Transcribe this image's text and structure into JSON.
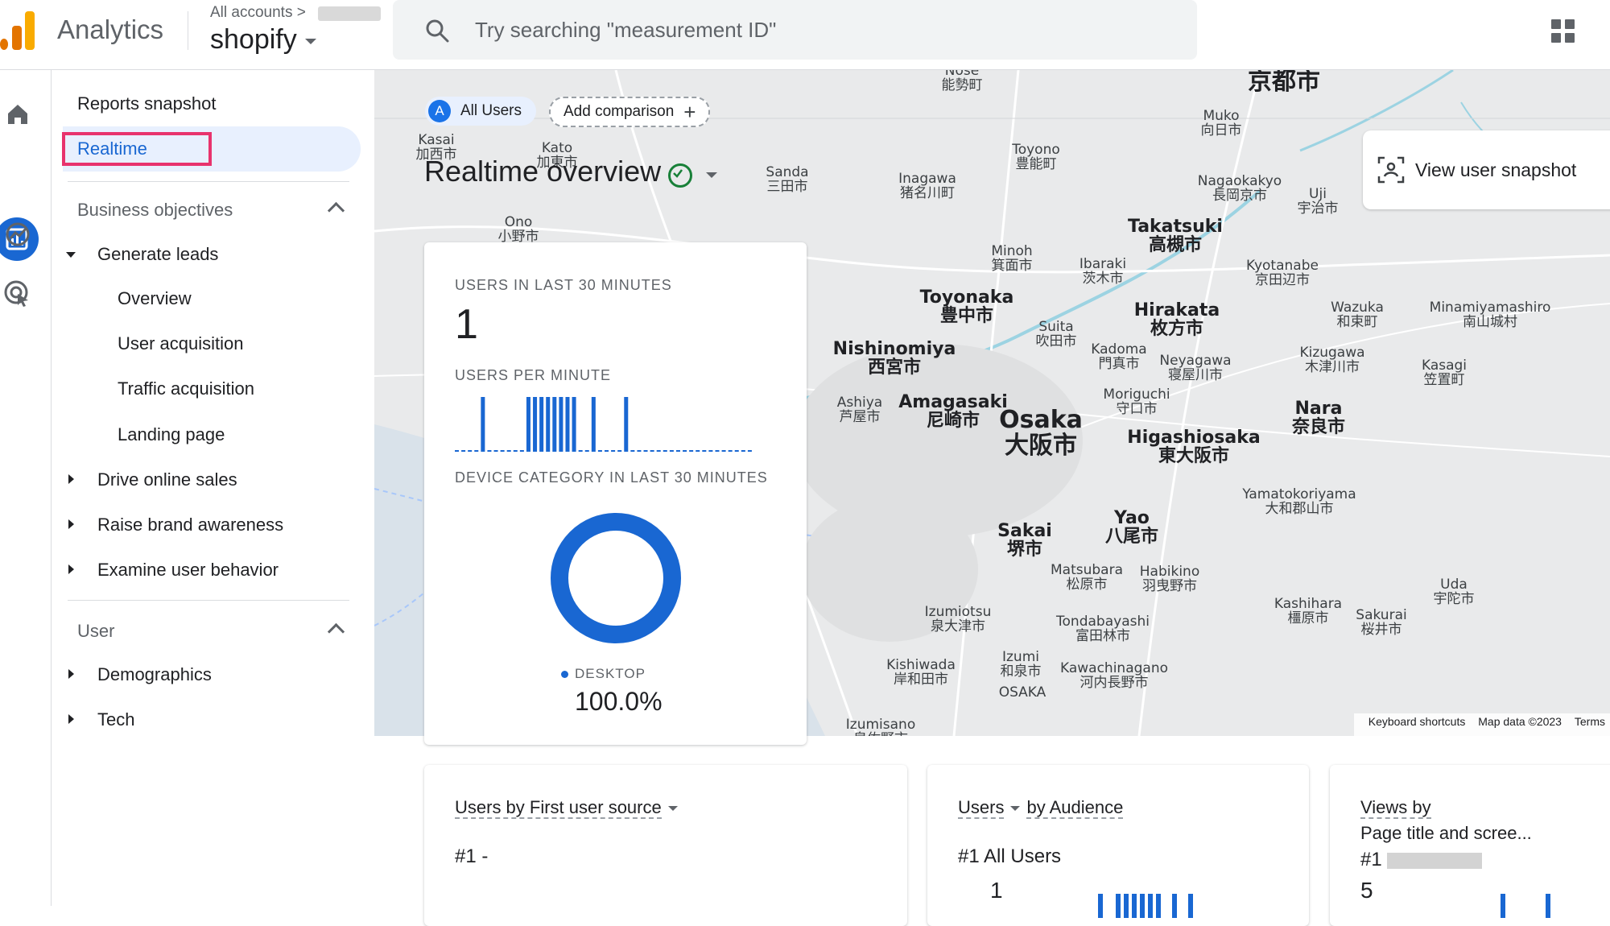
{
  "header": {
    "app_name": "Analytics",
    "breadcrumb": "All accounts",
    "breadcrumb_sep": ">",
    "property": "shopify",
    "search_placeholder": "Try searching \"measurement ID\""
  },
  "nav": {
    "reports_snapshot": "Reports snapshot",
    "realtime": "Realtime",
    "business_objectives": "Business objectives",
    "generate_leads": "Generate leads",
    "overview": "Overview",
    "user_acquisition": "User acquisition",
    "traffic_acquisition": "Traffic acquisition",
    "landing_page": "Landing page",
    "drive_online_sales": "Drive online sales",
    "raise_brand_awareness": "Raise brand awareness",
    "examine_user_behavior": "Examine user behavior",
    "user": "User",
    "demographics": "Demographics",
    "tech": "Tech"
  },
  "realtime": {
    "chip_all_letter": "A",
    "chip_all": "All Users",
    "chip_add": "Add comparison",
    "title": "Realtime overview",
    "view_snapshot": "View user snapshot"
  },
  "users_card": {
    "users_last30_caption": "USERS IN LAST 30 MINUTES",
    "users_last30": "1",
    "per_minute_caption": "USERS PER MINUTE",
    "per_minute_values": [
      0,
      0,
      0,
      0,
      1,
      0,
      0,
      0,
      0,
      0,
      0,
      1,
      1,
      1,
      1,
      1,
      1,
      1,
      1,
      0,
      0,
      1,
      0,
      0,
      0,
      0,
      1,
      0,
      0,
      0,
      0,
      0,
      0,
      0,
      0,
      0,
      0,
      0,
      0,
      0,
      0,
      0,
      0,
      0,
      0,
      0
    ],
    "device_caption": "DEVICE CATEGORY IN LAST 30 MINUTES",
    "device_label": "DESKTOP",
    "device_pct": "100.0%",
    "device_fraction": 1.0
  },
  "bottom_cards": {
    "card1_title": "Users by First user source",
    "card1_rank": "#1",
    "card1_value": "-",
    "card2_metric": "Users",
    "card2_title": "by Audience",
    "card2_rank": "#1",
    "card2_rank_value": "All Users",
    "card2_count": "1",
    "card3_title_line1": "Views by",
    "card3_title_line2": "Page title and scree...",
    "card3_rank": "#1",
    "card3_count": "5"
  },
  "map": {
    "places": [
      {
        "en": "Nose",
        "jp": "能勢町",
        "cls": "small"
      },
      {
        "en": "",
        "jp": "京都市",
        "cls": "big"
      },
      {
        "en": "Muko",
        "jp": "向日市",
        "cls": "small"
      },
      {
        "en": "Kasai",
        "jp": "加西市",
        "cls": "small"
      },
      {
        "en": "Kato",
        "jp": "加東市",
        "cls": "small"
      },
      {
        "en": "Toyono",
        "jp": "豊能町",
        "cls": "small"
      },
      {
        "en": "Sanda",
        "jp": "三田市",
        "cls": "small"
      },
      {
        "en": "Inagawa",
        "jp": "猪名川町",
        "cls": "small"
      },
      {
        "en": "Nagaokakyo",
        "jp": "長岡京市",
        "cls": "small"
      },
      {
        "en": "Uji",
        "jp": "宇治市",
        "cls": "small"
      },
      {
        "en": "Ono",
        "jp": "小野市",
        "cls": "small"
      },
      {
        "en": "Takatsuki",
        "jp": "高槻市",
        "cls": "mid"
      },
      {
        "en": "Minoh",
        "jp": "箕面市",
        "cls": "small"
      },
      {
        "en": "Ibaraki",
        "jp": "茨木市",
        "cls": "small"
      },
      {
        "en": "Kyotanabe",
        "jp": "京田辺市",
        "cls": "small"
      },
      {
        "en": "Toyonaka",
        "jp": "豊中市",
        "cls": "mid"
      },
      {
        "en": "Hirakata",
        "jp": "枚方市",
        "cls": "mid"
      },
      {
        "en": "Wazuka",
        "jp": "和束町",
        "cls": "small"
      },
      {
        "en": "Minamiyamashiro",
        "jp": "南山城村",
        "cls": "small"
      },
      {
        "en": "Suita",
        "jp": "吹田市",
        "cls": "small"
      },
      {
        "en": "Nishinomiya",
        "jp": "西宮市",
        "cls": "mid"
      },
      {
        "en": "Kadoma",
        "jp": "門真市",
        "cls": "small"
      },
      {
        "en": "Neyagawa",
        "jp": "寝屋川市",
        "cls": "small"
      },
      {
        "en": "Kizugawa",
        "jp": "木津川市",
        "cls": "small"
      },
      {
        "en": "Kasagi",
        "jp": "笠置町",
        "cls": "small"
      },
      {
        "en": "Moriguchi",
        "jp": "守口市",
        "cls": "small"
      },
      {
        "en": "Ashiya",
        "jp": "芦屋市",
        "cls": "small"
      },
      {
        "en": "Amagasaki",
        "jp": "尼崎市",
        "cls": "mid"
      },
      {
        "en": "Osaka",
        "jp": "大阪市",
        "cls": "big"
      },
      {
        "en": "Nara",
        "jp": "奈良市",
        "cls": "mid"
      },
      {
        "en": "Higashiosaka",
        "jp": "東大阪市",
        "cls": "mid"
      },
      {
        "en": "Yamatokoriyama",
        "jp": "大和郡山市",
        "cls": "small"
      },
      {
        "en": "Yao",
        "jp": "八尾市",
        "cls": "mid"
      },
      {
        "en": "Sakai",
        "jp": "堺市",
        "cls": "mid"
      },
      {
        "en": "Matsubara",
        "jp": "松原市",
        "cls": "small"
      },
      {
        "en": "Habikino",
        "jp": "羽曳野市",
        "cls": "small"
      },
      {
        "en": "Uda",
        "jp": "宇陀市",
        "cls": "small"
      },
      {
        "en": "Kashihara",
        "jp": "橿原市",
        "cls": "small"
      },
      {
        "en": "Sakurai",
        "jp": "桜井市",
        "cls": "small"
      },
      {
        "en": "Izumiotsu",
        "jp": "泉大津市",
        "cls": "small"
      },
      {
        "en": "Tondabayashi",
        "jp": "富田林市",
        "cls": "small"
      },
      {
        "en": "Kishiwada",
        "jp": "岸和田市",
        "cls": "small"
      },
      {
        "en": "Izumi",
        "jp": "和泉市",
        "cls": "small"
      },
      {
        "en": "Kawachinagano",
        "jp": "河内長野市",
        "cls": "small"
      },
      {
        "en": "OSAKA",
        "jp": "",
        "cls": "small"
      },
      {
        "en": "Izumisano",
        "jp": "泉佐野市",
        "cls": "small"
      }
    ],
    "footer_shortcuts": "Keyboard shortcuts",
    "footer_data": "Map data ©2023",
    "footer_terms": "Terms"
  }
}
